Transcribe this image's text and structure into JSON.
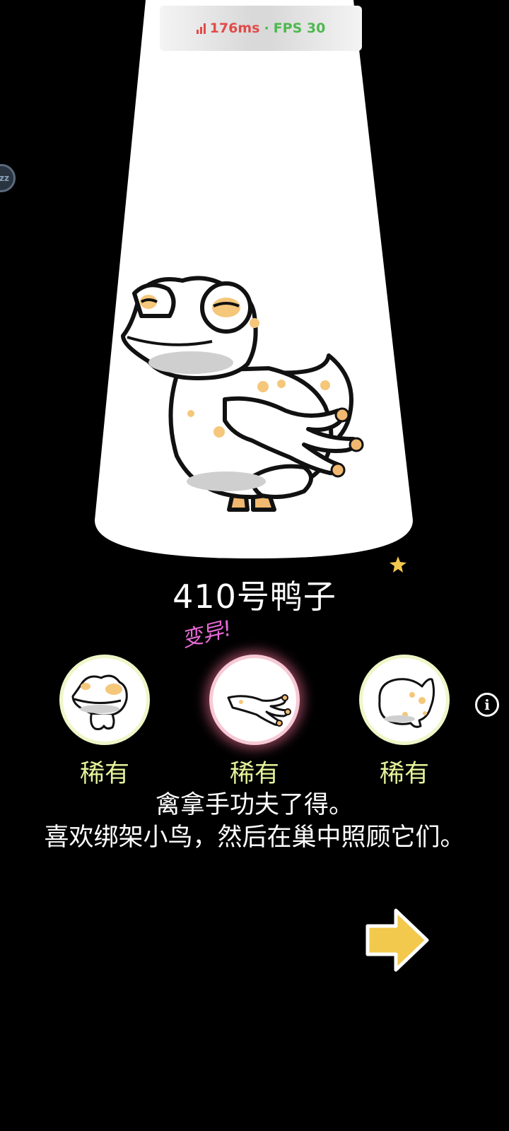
{
  "status": {
    "ping": "176ms",
    "separator": "·",
    "fps": "FPS 30"
  },
  "sleep_button": {
    "label": "zz"
  },
  "character": {
    "name": "410号鸭子",
    "mutation_label": "变异!",
    "parts": [
      {
        "id": "head",
        "rarity": "稀有",
        "icon": "frog-head-icon"
      },
      {
        "id": "arm",
        "rarity": "稀有",
        "icon": "frog-arm-icon",
        "mutated": true
      },
      {
        "id": "body",
        "rarity": "稀有",
        "icon": "frog-body-icon"
      }
    ],
    "description": "禽拿手功夫了得。\n喜欢绑架小鸟，然后在巢中照顾它们。"
  },
  "info_button": {
    "label": "i"
  },
  "colors": {
    "background": "#000000",
    "spot_orange": "#f5c77a",
    "rarity_text": "#e6f39a",
    "mutation_text": "#e86ad8",
    "arrow_fill": "#f2c94c"
  }
}
